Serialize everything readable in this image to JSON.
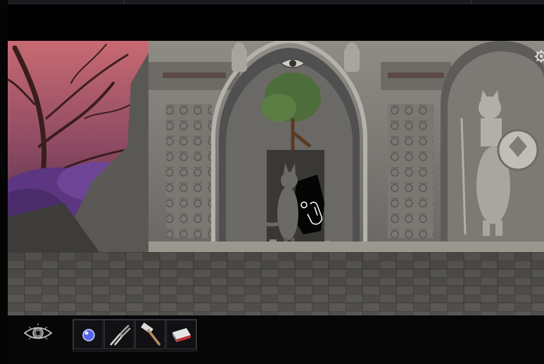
{
  "scene": {
    "name": "temple-niche-room",
    "hotspot": "broken-wall-hole"
  },
  "hud": {
    "look_icon": "eye-icon",
    "settings_icon": "gear-icon"
  },
  "inventory": {
    "items": [
      {
        "id": "orb",
        "icon": "blue-orb-icon"
      },
      {
        "id": "pliers",
        "icon": "pliers-icon"
      },
      {
        "id": "hammer",
        "icon": "hammer-icon"
      },
      {
        "id": "eraser",
        "icon": "eraser-icon"
      }
    ]
  },
  "colors": {
    "sky": "#b35a6e",
    "foliage": "#6a3f8e",
    "stone": "#8a8782",
    "floor": "#4a4844",
    "orb": "#6677ff"
  }
}
